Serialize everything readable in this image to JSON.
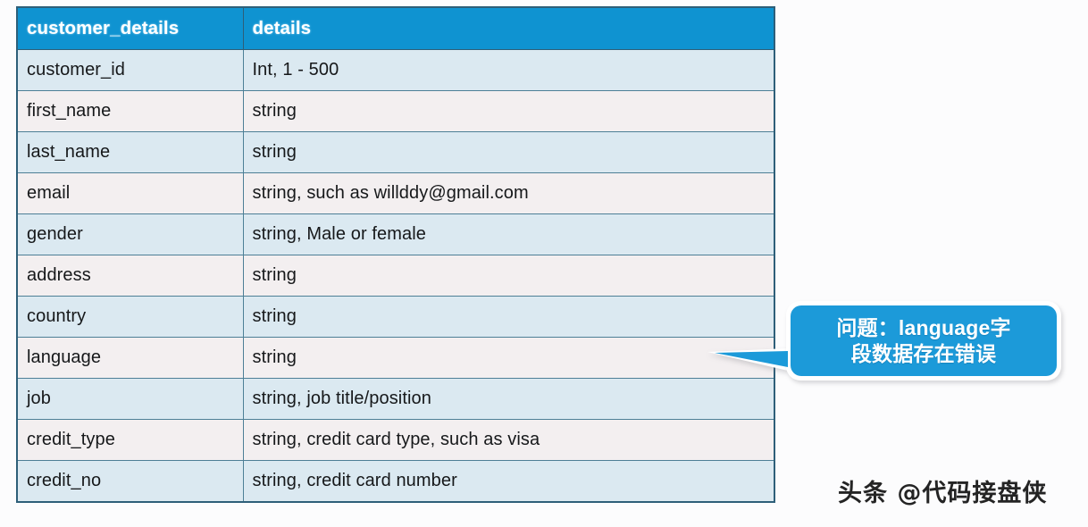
{
  "table": {
    "columns": [
      "customer_details",
      "details"
    ],
    "rows": [
      {
        "field": "customer_id",
        "details": "Int, 1 - 500"
      },
      {
        "field": "first_name",
        "details": "string"
      },
      {
        "field": "last_name",
        "details": "string"
      },
      {
        "field": "email",
        "details": "string, such as willddy@gmail.com"
      },
      {
        "field": "gender",
        "details": "string, Male or female"
      },
      {
        "field": "address",
        "details": "string"
      },
      {
        "field": "country",
        "details": "string"
      },
      {
        "field": "language",
        "details": "string"
      },
      {
        "field": "job",
        "details": "string, job title/position"
      },
      {
        "field": "credit_type",
        "details": "string, credit card type, such as visa"
      },
      {
        "field": "credit_no",
        "details": "string, credit card number"
      }
    ]
  },
  "callout": {
    "text": "问题：language字段数据存在错误",
    "line1": "问题：language字",
    "line2": "段数据存在错误",
    "fill_color": "#1c9ad9",
    "outline_color": "#ffffff",
    "text_color": "#ffffff",
    "points_at_row": "language"
  },
  "watermark": {
    "text": "头条 @代码接盘侠"
  },
  "colors": {
    "header_background": "#0f93d1",
    "header_text": "#ffffff",
    "row_blue": "#dbe9f1",
    "row_gray": "#f3eff0",
    "border": "#4d7f96",
    "outer_border": "#2e5f79",
    "page_background": "#fcfcfd",
    "body_text": "#16181a"
  }
}
